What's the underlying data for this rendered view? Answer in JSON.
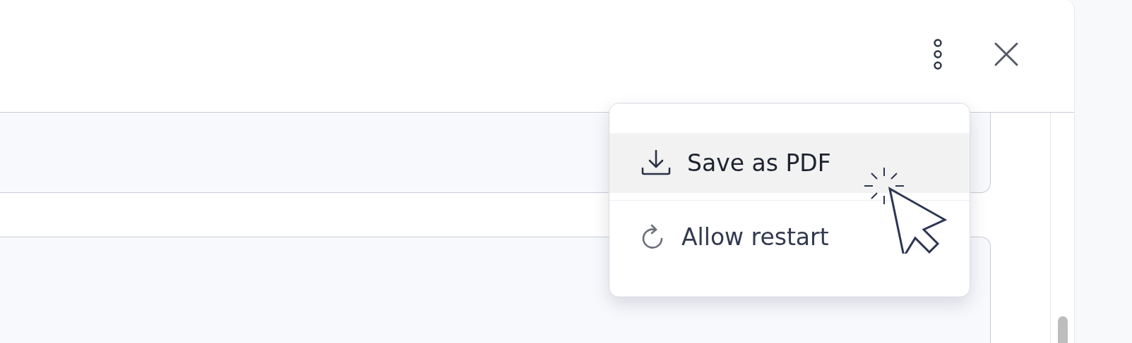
{
  "menu": {
    "items": [
      {
        "kind": "download",
        "label": "Save as PDF",
        "selected": true
      },
      {
        "kind": "restart",
        "label": "Allow restart",
        "selected": false
      }
    ]
  }
}
